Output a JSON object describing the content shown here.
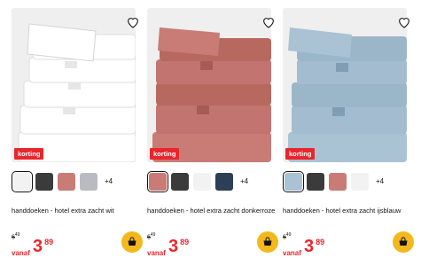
{
  "products": [
    {
      "badge": "korting",
      "more_colors": "+4",
      "title": "handdoeken - hotel extra zacht wit",
      "old_price": "6",
      "old_price_dec": "49",
      "vanaf": "vanaf",
      "price_int": "3",
      "price_dec": "89",
      "colors": {
        "image_bg": "#efefef",
        "towel": "#ffffff",
        "shade": "#d9d9d9"
      }
    },
    {
      "badge": "korting",
      "more_colors": "+4",
      "title": "handdoeken - hotel extra zacht donkerroze",
      "old_price": "6",
      "old_price_dec": "49",
      "vanaf": "vanaf",
      "price_int": "3",
      "price_dec": "89",
      "colors": {
        "image_bg": "#efefef",
        "towel": "#c97b76",
        "shade": "#a85a56"
      }
    },
    {
      "badge": "korting",
      "more_colors": "+4",
      "title": "handdoeken - hotel extra zacht ijsblauw",
      "old_price": "6",
      "old_price_dec": "49",
      "vanaf": "vanaf",
      "price_int": "3",
      "price_dec": "89",
      "colors": {
        "image_bg": "#efefef",
        "towel": "#a9c2d4",
        "shade": "#7f9db3"
      }
    }
  ],
  "swatch_colors": [
    "#f2f2f2",
    "#3b3b3b",
    "#c97b76",
    "#b8bcc0",
    "#2e3e57",
    "#a9c2d4"
  ],
  "accent": "#e8262c",
  "cart_color": "#f3b81d"
}
